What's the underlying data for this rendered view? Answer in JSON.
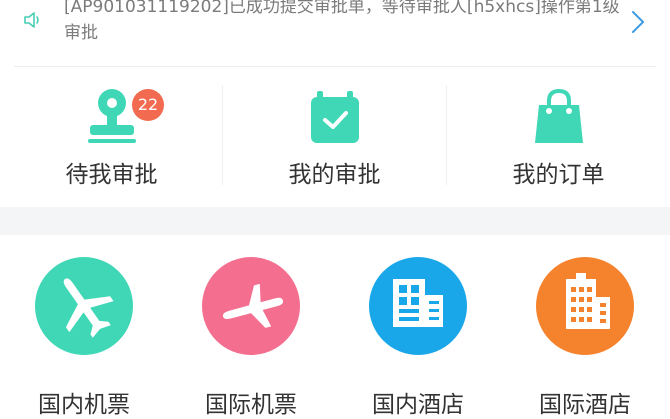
{
  "notice": {
    "text": "[AP901031119202]已成功提交审批单，等待审批人[h5xhcs]操作第1级审批",
    "icon": "speaker-icon"
  },
  "approvals": [
    {
      "label": "待我审批",
      "badge": "22",
      "icon": "approval-stamp-icon"
    },
    {
      "label": "我的审批",
      "icon": "calendar-check-icon"
    },
    {
      "label": "我的订单",
      "icon": "shopping-bag-icon"
    }
  ],
  "services": [
    {
      "label": "国内机票",
      "icon": "airplane-icon",
      "color": "#3fd7b5"
    },
    {
      "label": "国际机票",
      "icon": "airplane-icon",
      "color": "#f46f8f"
    },
    {
      "label": "国内酒店",
      "icon": "hotel-building-icon",
      "color": "#1aa7ea"
    },
    {
      "label": "国际酒店",
      "icon": "hotel-building-icon",
      "color": "#f5822c"
    }
  ],
  "colors": {
    "teal": "#3fd7b5",
    "badge": "#f26a4f"
  }
}
